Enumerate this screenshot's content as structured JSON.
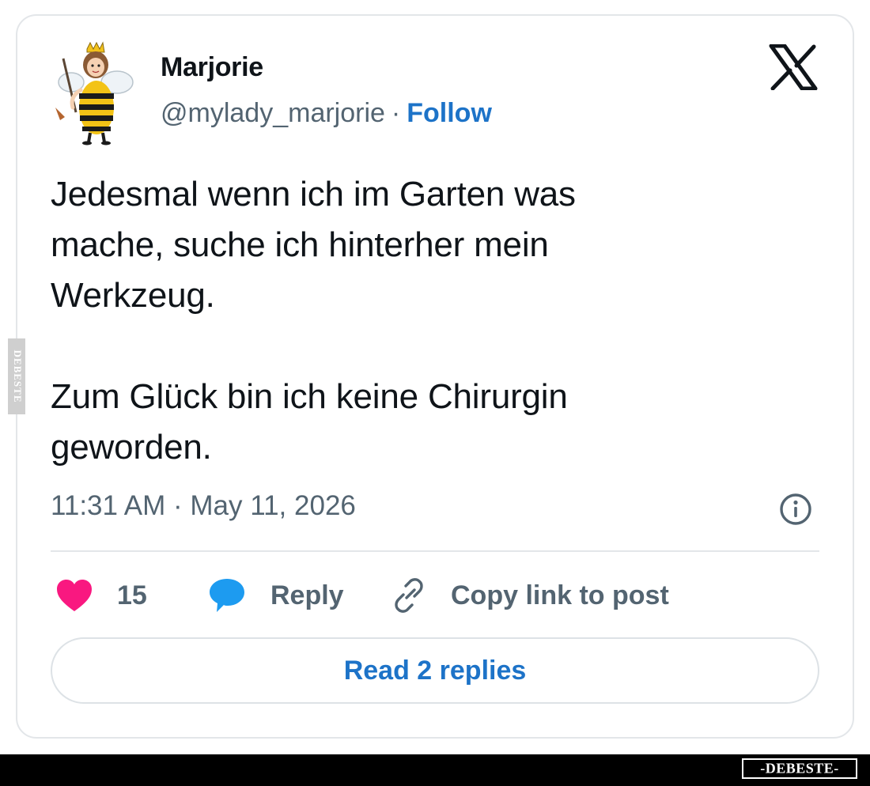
{
  "post": {
    "author": {
      "name": "Marjorie",
      "handle": "@mylady_marjorie",
      "separator": "·",
      "follow_label": "Follow",
      "avatar_icon": "bee-costume-avatar"
    },
    "platform_icon": "x-logo-icon",
    "text": "Jedesmal wenn ich im Garten was\nmache, suche ich hinterher mein\nWerkzeug.\n\nZum Glück bin ich keine Chirurgin\ngeworden.",
    "timestamp": "11:31 AM · May 11, 2026",
    "info_icon": "info-icon",
    "actions": {
      "like_count": "15",
      "reply_label": "Reply",
      "copy_link_label": "Copy link to post"
    },
    "read_replies_label": "Read 2 replies"
  },
  "watermark": {
    "brand": "-DEBESTE-",
    "side_brand": "DEBESTE"
  },
  "colors": {
    "text": "#0f1419",
    "muted": "#536471",
    "link": "#1d73c8",
    "like": "#f91880",
    "reply": "#1d9bf0",
    "border": "#e3e6e9"
  }
}
